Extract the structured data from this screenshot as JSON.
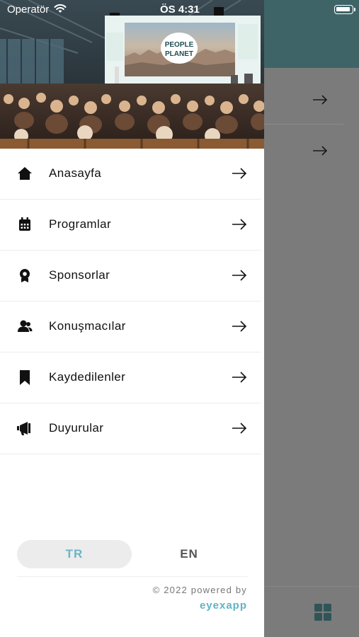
{
  "status_bar": {
    "carrier": "Operatör",
    "time": "ÖS 4:31"
  },
  "menu": [
    {
      "label": "Anasayfa",
      "icon": "home-icon"
    },
    {
      "label": "Programlar",
      "icon": "calendar-icon"
    },
    {
      "label": "Sponsorlar",
      "icon": "award-icon"
    },
    {
      "label": "Konuşmacılar",
      "icon": "people-icon"
    },
    {
      "label": "Kaydedilenler",
      "icon": "bookmark-icon"
    },
    {
      "label": "Duyurular",
      "icon": "megaphone-icon"
    }
  ],
  "hero": {
    "screen_text_line1": "PEOPLE",
    "screen_text_line2": "PLANET"
  },
  "language": {
    "selected": "TR",
    "options": [
      "TR",
      "EN"
    ]
  },
  "footer": {
    "powered_by": "© 2022 powered by",
    "brand": "eyexapp"
  },
  "colors": {
    "header_teal": "#3f6467",
    "accent": "#5fb4c6",
    "overlay_gray": "#7b7b7b"
  }
}
